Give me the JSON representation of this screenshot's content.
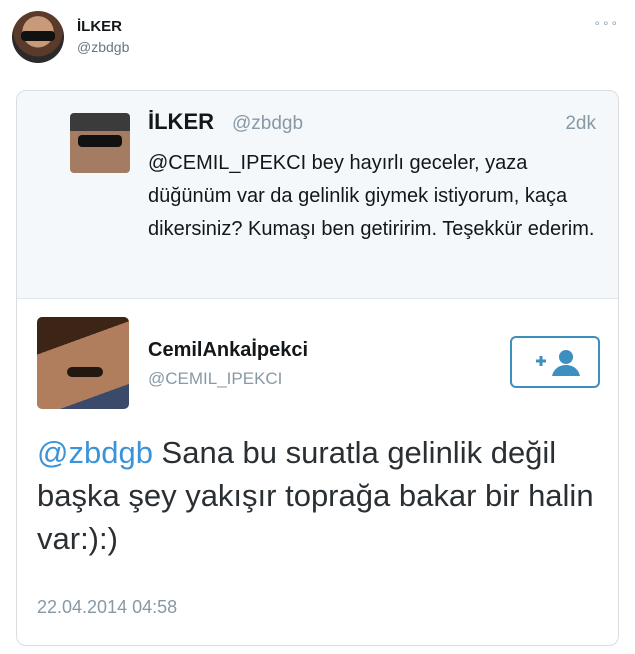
{
  "author": {
    "name": "İLKER",
    "handle": "@zbdgb",
    "more_icon": "ellipsis-icon"
  },
  "quoted": {
    "name": "İLKER",
    "handle": "@zbdgb",
    "time": "2dk",
    "text": "@CEMIL_IPEKCI bey hayırlı geceler, yaza düğünüm var da gelinlik giymek istiyorum, kaça dikersiniz? Kumaşı ben getiririm. Teşekkür ederim."
  },
  "reply": {
    "name": "CemilAnkaİpekci",
    "handle": "@CEMIL_IPEKCI",
    "follow_icon": "add-user-icon",
    "mention": "@zbdgb",
    "text": " Sana bu suratla gelinlik değil başka şey yakışır toprağa bakar bir halin var:):)",
    "date": "22.04.2014 04:58"
  },
  "colors": {
    "link": "#3b94d9",
    "muted": "#8899a6",
    "follow_border": "#3d8fbf"
  }
}
